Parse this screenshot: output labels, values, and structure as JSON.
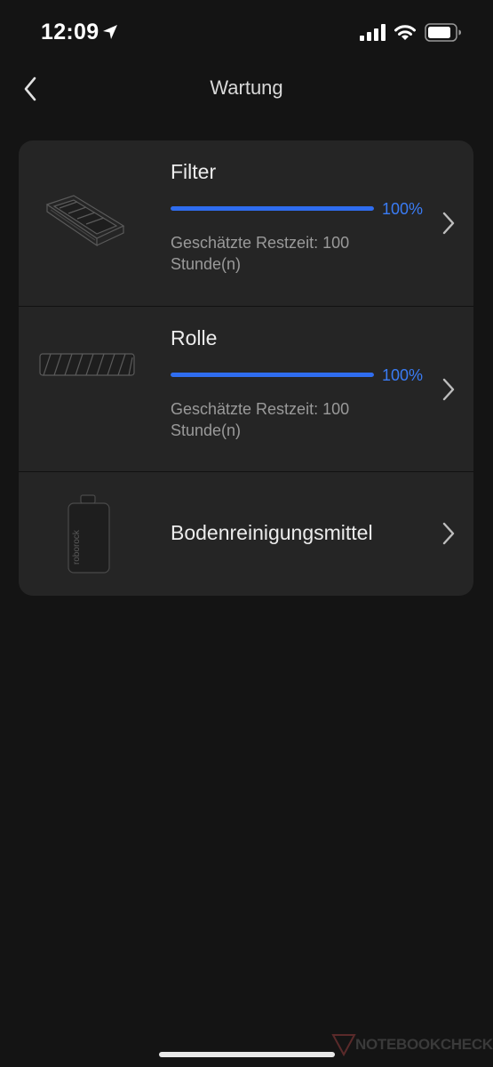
{
  "status_bar": {
    "time": "12:09"
  },
  "nav": {
    "title": "Wartung"
  },
  "items": [
    {
      "title": "Filter",
      "progress": 1.0,
      "progress_text": "100%",
      "remaining_text": "Geschätzte Restzeit: 100 Stunde(n)"
    },
    {
      "title": "Rolle",
      "progress": 1.0,
      "progress_text": "100%",
      "remaining_text": "Geschätzte Restzeit: 100 Stunde(n)"
    },
    {
      "title": "Bodenreinigungsmittel",
      "bottle_label": "roborock"
    }
  ],
  "watermark": "NOTEBOOKCHECK",
  "colors": {
    "background": "#141414",
    "card": "#252525",
    "accent": "#2f6df0"
  },
  "icons": {
    "back": "chevron-left-icon",
    "row": "chevron-right-icon",
    "location": "location-arrow-icon",
    "signal": "cellular-signal-icon",
    "wifi": "wifi-icon",
    "battery": "battery-icon"
  }
}
